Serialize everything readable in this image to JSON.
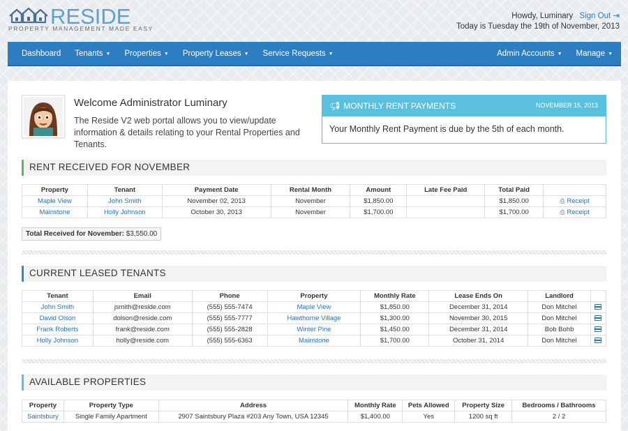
{
  "brand": {
    "name": "RESIDE",
    "tagline": "PROPERTY MANAGEMENT MADE EASY",
    "accent": "#5aa0d4"
  },
  "user": {
    "greeting": "Howdy, Luminary",
    "signout": "Sign Out",
    "today": "Today is Tuesday the 19th of November, 2013"
  },
  "nav": {
    "left": [
      "Dashboard",
      "Tenants",
      "Properties",
      "Property Leases",
      "Service Requests"
    ],
    "right": [
      "Admin Accounts",
      "Manage"
    ],
    "bg": "#2f7dc1"
  },
  "welcome": {
    "title": "Welcome Administrator Luminary",
    "text": "The Reside V2 web portal allows you to view/update information & details relating to your Rental Properties and Tenants."
  },
  "notice": {
    "title": "MONTHLY RENT PAYMENTS",
    "date": "NOVEMBER 15, 2013",
    "body": "Your Monthly Rent Payment is due by the 5th of each month.",
    "icon": "megaphone-icon"
  },
  "rent_received": {
    "heading": "RENT RECEIVED FOR NOVEMBER",
    "columns": [
      "Property",
      "Tenant",
      "Payment Date",
      "Rental Month",
      "Amount",
      "Late Fee Paid",
      "Total Paid",
      ""
    ],
    "rows": [
      [
        "Maple View",
        "John Smith",
        "November 02, 2013",
        "November",
        "$1,850.00",
        "",
        "$1,850.00",
        "Receipt"
      ],
      [
        "Mainstone",
        "Holly Johnson",
        "October 30, 2013",
        "November",
        "$1,700.00",
        "",
        "$1,700.00",
        "Receipt"
      ]
    ],
    "total_label": "Total Received for November:",
    "total_value": "$3,550.00"
  },
  "leased": {
    "heading": "CURRENT LEASED TENANTS",
    "columns": [
      "Tenant",
      "Email",
      "Phone",
      "Property",
      "Monthly Rate",
      "Lease Ends On",
      "Landlord",
      ""
    ],
    "rows": [
      [
        "John Smith",
        "jsmith@reside.com",
        "(555) 555-7474",
        "Maple View",
        "$1,850.00",
        "December 31, 2014",
        "Don Mitchel"
      ],
      [
        "David Olson",
        "dolson@reside.com",
        "(555) 555-7777",
        "Hawthorne Village",
        "$1,300.00",
        "November 30, 2015",
        "Don Mitchel"
      ],
      [
        "Frank Roberts",
        "frank@reside.com",
        "(555) 555-2828",
        "Winter Pine",
        "$1,450.00",
        "December 31, 2014",
        "Bob Bohb"
      ],
      [
        "Holly Johnson",
        "holly@reside.com",
        "(555) 555-6363",
        "Mainstone",
        "$1,700.00",
        "October 31, 2014",
        "Don Mitchel"
      ]
    ]
  },
  "available": {
    "heading": "AVAILABLE PROPERTIES",
    "columns": [
      "Property",
      "Property Type",
      "Address",
      "Monthly Rate",
      "Pets Allowed",
      "Property Size",
      "Bedrooms / Bathrooms"
    ],
    "rows": [
      [
        "Saintsbury",
        "Single Family Apartment",
        "2907 Saintsbury Plaza #203 Any Town, USA 12345",
        "$1,400.00",
        "Yes",
        "1200 sq ft",
        "2 / 2"
      ]
    ]
  }
}
